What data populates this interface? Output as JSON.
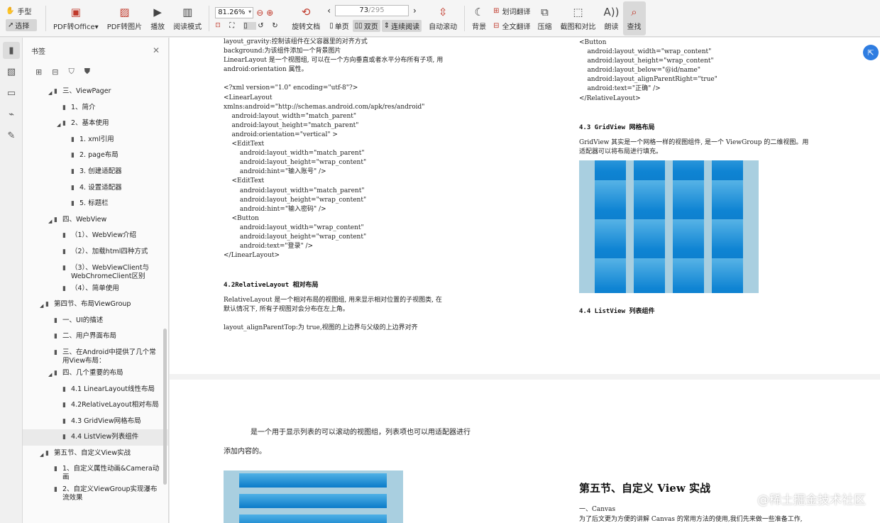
{
  "toolbar": {
    "hand": "手型",
    "select": "选择",
    "pdf_office": "PDF转Office",
    "pdf_office_arrow": "▾",
    "pdf_image": "PDF转图片",
    "play": "播放",
    "read_mode": "阅读模式",
    "zoom": "81.26%",
    "rotate": "旋转文档",
    "page_current": "73",
    "page_total": "/295",
    "single": "单页",
    "double": "双页",
    "continuous": "连续阅读",
    "auto_scroll": "自动滚动",
    "background": "背景",
    "word_translate": "划词翻译",
    "full_translate": "全文翻译",
    "compress": "压缩",
    "screenshot": "截图和对比",
    "read_aloud": "朗读",
    "find": "查找"
  },
  "panel": {
    "title": "书签",
    "items": [
      {
        "label": "三、ViewPager",
        "level": 1,
        "toggle": "◢"
      },
      {
        "label": "1、简介",
        "level": 2,
        "toggle": ""
      },
      {
        "label": "2、基本使用",
        "level": 2,
        "toggle": "◢"
      },
      {
        "label": "1. xml引用",
        "level": 3,
        "toggle": ""
      },
      {
        "label": "2. page布局",
        "level": 3,
        "toggle": ""
      },
      {
        "label": "3. 创建适配器",
        "level": 3,
        "toggle": ""
      },
      {
        "label": "4. 设置适配器",
        "level": 3,
        "toggle": ""
      },
      {
        "label": "5. 标题栏",
        "level": 3,
        "toggle": ""
      },
      {
        "label": "四、WebView",
        "level": 1,
        "toggle": "◢"
      },
      {
        "label": "（1）、WebView介绍",
        "level": 2,
        "toggle": ""
      },
      {
        "label": "（2）、加载html四种方式",
        "level": 2,
        "toggle": ""
      },
      {
        "label": "（3）、WebViewClient与 WebChromeClient区别",
        "level": 2,
        "toggle": ""
      },
      {
        "label": "（4）、简单使用",
        "level": 2,
        "toggle": ""
      },
      {
        "label": "第四节、布局ViewGroup",
        "level": 0,
        "toggle": "◢"
      },
      {
        "label": "一、UI的描述",
        "level": 1,
        "toggle": ""
      },
      {
        "label": "二、用户界面布局",
        "level": 1,
        "toggle": ""
      },
      {
        "label": "三、在Android中提供了几个常用View布局：",
        "level": 1,
        "toggle": ""
      },
      {
        "label": "四、几个重要的布局",
        "level": 1,
        "toggle": "◢"
      },
      {
        "label": "4.1 LinearLayout线性布局",
        "level": 2,
        "toggle": ""
      },
      {
        "label": "4.2RelativeLayout相对布局",
        "level": 2,
        "toggle": ""
      },
      {
        "label": "4.3 GridView网格布局",
        "level": 2,
        "toggle": ""
      },
      {
        "label": "4.4 ListView列表组件",
        "level": 2,
        "toggle": "",
        "selected": true
      },
      {
        "label": "第五节、自定义View实战",
        "level": 0,
        "toggle": "◢"
      },
      {
        "label": "1、自定义属性动画&Camera动画",
        "level": 1,
        "toggle": ""
      },
      {
        "label": "2、自定义ViewGroup实现瀑布流效果",
        "level": 1,
        "toggle": ""
      }
    ]
  },
  "doc": {
    "left_code": "layout_gravity:控制该组件在父容器里的对齐方式\nbackground:为该组件添加一个背景图片\nLinearLayout 是一个视图组, 可以在一个方向垂直或者水平分布所有子项, 用\nandroid:orientation 属性。\n\n<?xml version=\"1.0\" encoding=\"utf-8\"?>\n<LinearLayout\nxmlns:android=\"http://schemas.android.com/apk/res/android\"\n    android:layout_width=\"match_parent\"\n    android:layout_height=\"match_parent\"\n    android:orientation=\"vertical\" >\n    <EditText\n        android:layout_width=\"match_parent\"\n        android:layout_height=\"wrap_content\"\n        android:hint=\"输入账号\" />\n    <EditText\n        android:layout_width=\"match_parent\"\n        android:layout_height=\"wrap_content\"\n        android:hint=\"输入密码\" />\n    <Button\n        android:layout_width=\"wrap_content\"\n        android:layout_height=\"wrap_content\"\n        android:text=\"登录\" />\n</LinearLayout>",
    "heading_42": "4.2RelativeLayout 相对布局",
    "relative_text": "RelativeLayout 是一个相对布局的视图组, 用来显示相对位置的子视图类, 在\n默认情况下, 所有子视图对会分布在左上角。\n\nlayout_alignParentTop:为 true,视图的上边界与父级的上边界对齐",
    "right_code": "<Button\n    android:layout_width=\"wrap_content\"\n    android:layout_height=\"wrap_content\"\n    android:layout_below=\"@id/name\"\n    android:layout_alignParentRight=\"true\"\n    android:text=\"正确\" />\n</RelativeLayout>",
    "heading_43": "4.3 GridView 网格布局",
    "grid_text": "GridView 其实是一个网格一样的视图组件, 是一个 ViewGroup 的二维视图。用\n适配器可以将布局进行填充。",
    "heading_44": "4.4 ListView 列表组件",
    "list_text_1": "是一个用于显示列表的可以滚动的视图组，列表项也可以用适配器进行",
    "list_text_2": "添加内容的。",
    "section5": "第五节、自定义 View 实战",
    "canvas_label": "一、Canvas",
    "canvas_text": "为了后文更为方便的讲解 Canvas 的常用方法的使用,我们先来做一些准备工作,",
    "watermark": "@稀土掘金技术社区"
  }
}
